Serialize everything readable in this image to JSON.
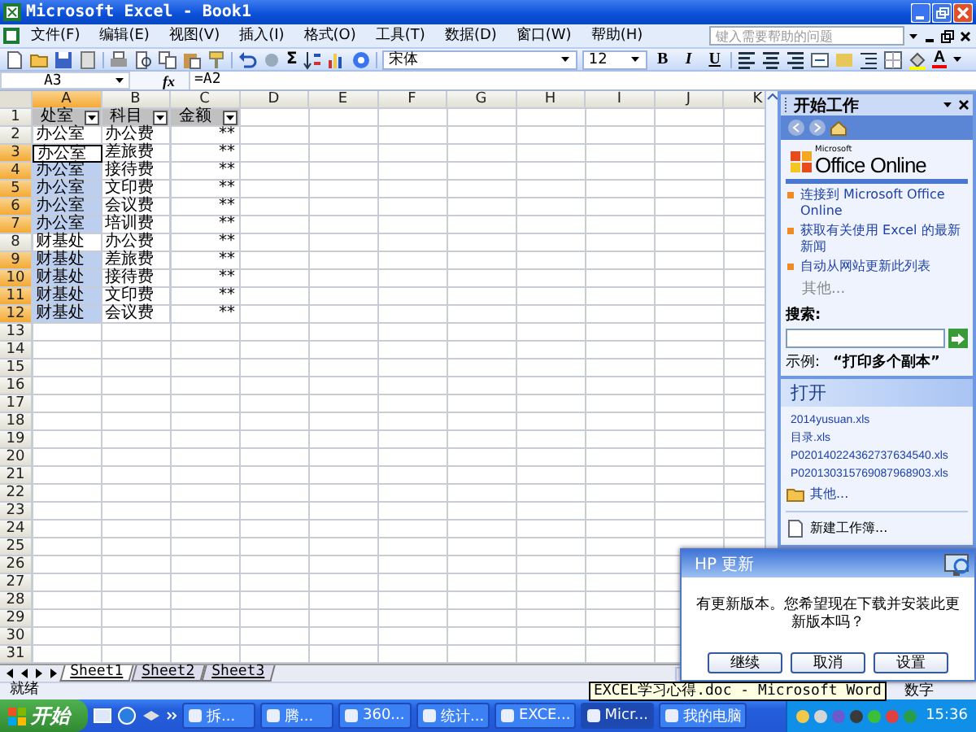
{
  "window": {
    "title": "Microsoft Excel - Book1"
  },
  "menu": [
    "文件(F)",
    "编辑(E)",
    "视图(V)",
    "插入(I)",
    "格式(O)",
    "工具(T)",
    "数据(D)",
    "窗口(W)",
    "帮助(H)"
  ],
  "help_box": {
    "placeholder": "键入需要帮助的问题"
  },
  "toolbar": {
    "sum": "Σ",
    "font": "宋体",
    "size": "12",
    "styles": [
      "B",
      "I",
      "U"
    ],
    "font_color": "A"
  },
  "formula_bar": {
    "name_box": "A3",
    "fx": "fx",
    "formula": "=A2"
  },
  "sheet": {
    "columns": [
      {
        "label": "A",
        "selected": true
      },
      {
        "label": "B",
        "selected": false
      },
      {
        "label": "C",
        "selected": false
      },
      {
        "label": "D",
        "selected": false
      },
      {
        "label": "E",
        "selected": false
      },
      {
        "label": "F",
        "selected": false
      },
      {
        "label": "G",
        "selected": false
      },
      {
        "label": "H",
        "selected": false
      },
      {
        "label": "I",
        "selected": false
      },
      {
        "label": "J",
        "selected": false
      },
      {
        "label": "K",
        "selected": false
      }
    ],
    "rows": [
      {
        "number": "1",
        "selected": false,
        "cells": [
          {
            "text": "处室",
            "kind": "header",
            "selected": false,
            "active": false
          },
          {
            "text": "科目",
            "kind": "header",
            "selected": false,
            "active": false
          },
          {
            "text": "金额",
            "kind": "header",
            "selected": false,
            "active": false
          }
        ]
      },
      {
        "number": "2",
        "selected": false,
        "cells": [
          {
            "text": "办公室",
            "kind": "text",
            "selected": false,
            "active": false
          },
          {
            "text": "办公费",
            "kind": "text",
            "selected": false,
            "active": false
          },
          {
            "text": "**",
            "kind": "number",
            "selected": false,
            "active": false
          }
        ]
      },
      {
        "number": "3",
        "selected": true,
        "cells": [
          {
            "text": "办公室",
            "kind": "text",
            "selected": false,
            "active": true
          },
          {
            "text": "差旅费",
            "kind": "text",
            "selected": false,
            "active": false
          },
          {
            "text": "**",
            "kind": "number",
            "selected": false,
            "active": false
          }
        ]
      },
      {
        "number": "4",
        "selected": true,
        "cells": [
          {
            "text": "办公室",
            "kind": "text",
            "selected": true,
            "active": false
          },
          {
            "text": "接待费",
            "kind": "text",
            "selected": false,
            "active": false
          },
          {
            "text": "**",
            "kind": "number",
            "selected": false,
            "active": false
          }
        ]
      },
      {
        "number": "5",
        "selected": true,
        "cells": [
          {
            "text": "办公室",
            "kind": "text",
            "selected": true,
            "active": false
          },
          {
            "text": "文印费",
            "kind": "text",
            "selected": false,
            "active": false
          },
          {
            "text": "**",
            "kind": "number",
            "selected": false,
            "active": false
          }
        ]
      },
      {
        "number": "6",
        "selected": true,
        "cells": [
          {
            "text": "办公室",
            "kind": "text",
            "selected": true,
            "active": false
          },
          {
            "text": "会议费",
            "kind": "text",
            "selected": false,
            "active": false
          },
          {
            "text": "**",
            "kind": "number",
            "selected": false,
            "active": false
          }
        ]
      },
      {
        "number": "7",
        "selected": true,
        "cells": [
          {
            "text": "办公室",
            "kind": "text",
            "selected": true,
            "active": false
          },
          {
            "text": "培训费",
            "kind": "text",
            "selected": false,
            "active": false
          },
          {
            "text": "**",
            "kind": "number",
            "selected": false,
            "active": false
          }
        ]
      },
      {
        "number": "8",
        "selected": false,
        "cells": [
          {
            "text": "财基处",
            "kind": "text",
            "selected": false,
            "active": false
          },
          {
            "text": "办公费",
            "kind": "text",
            "selected": false,
            "active": false
          },
          {
            "text": "**",
            "kind": "number",
            "selected": false,
            "active": false
          }
        ]
      },
      {
        "number": "9",
        "selected": true,
        "cells": [
          {
            "text": "财基处",
            "kind": "text",
            "selected": true,
            "active": false
          },
          {
            "text": "差旅费",
            "kind": "text",
            "selected": false,
            "active": false
          },
          {
            "text": "**",
            "kind": "number",
            "selected": false,
            "active": false
          }
        ]
      },
      {
        "number": "10",
        "selected": true,
        "cells": [
          {
            "text": "财基处",
            "kind": "text",
            "selected": true,
            "active": false
          },
          {
            "text": "接待费",
            "kind": "text",
            "selected": false,
            "active": false
          },
          {
            "text": "**",
            "kind": "number",
            "selected": false,
            "active": false
          }
        ]
      },
      {
        "number": "11",
        "selected": true,
        "cells": [
          {
            "text": "财基处",
            "kind": "text",
            "selected": true,
            "active": false
          },
          {
            "text": "文印费",
            "kind": "text",
            "selected": false,
            "active": false
          },
          {
            "text": "**",
            "kind": "number",
            "selected": false,
            "active": false
          }
        ]
      },
      {
        "number": "12",
        "selected": true,
        "cells": [
          {
            "text": "财基处",
            "kind": "text",
            "selected": true,
            "active": false
          },
          {
            "text": "会议费",
            "kind": "text",
            "selected": false,
            "active": false
          },
          {
            "text": "**",
            "kind": "number",
            "selected": false,
            "active": false
          }
        ]
      },
      {
        "number": "13",
        "selected": false
      },
      {
        "number": "14",
        "selected": false
      },
      {
        "number": "15",
        "selected": false
      },
      {
        "number": "16",
        "selected": false
      },
      {
        "number": "17",
        "selected": false
      },
      {
        "number": "18",
        "selected": false
      },
      {
        "number": "19",
        "selected": false
      },
      {
        "number": "20",
        "selected": false
      },
      {
        "number": "21",
        "selected": false
      },
      {
        "number": "22",
        "selected": false
      },
      {
        "number": "23",
        "selected": false
      },
      {
        "number": "24",
        "selected": false
      },
      {
        "number": "25",
        "selected": false
      },
      {
        "number": "26",
        "selected": false
      },
      {
        "number": "27",
        "selected": false
      },
      {
        "number": "28",
        "selected": false
      },
      {
        "number": "29",
        "selected": false
      },
      {
        "number": "30",
        "selected": false
      },
      {
        "number": "31",
        "selected": false
      }
    ],
    "tabs": [
      {
        "label": "Sheet1",
        "selected": true
      },
      {
        "label": "Sheet2",
        "selected": false
      },
      {
        "label": "Sheet3",
        "selected": false
      }
    ]
  },
  "task_pane": {
    "title": "开始工作",
    "logo": {
      "small": "Microsoft",
      "name": "Office Online"
    },
    "links": [
      "连接到 Microsoft Office Online",
      "获取有关使用 Excel 的最新新闻",
      "自动从网站更新此列表"
    ],
    "more": "其他...",
    "search": {
      "label": "搜索:",
      "example_label": "示例:",
      "example": "“打印多个副本”"
    },
    "open": {
      "title": "打开",
      "files": [
        "2014yusuan.xls",
        "目录.xls",
        "P020140224362737634540.xls",
        "P020130315769087968903.xls"
      ],
      "more": "其他..."
    },
    "new_workbook": "新建工作簿..."
  },
  "status_bar": {
    "left": "就绪",
    "right": "数字"
  },
  "tooltip": "EXCEL学习心得.doc - Microsoft Word",
  "dialog": {
    "title": "HP 更新",
    "message": "有更新版本。您希望现在下载并安装此更新版本吗？",
    "buttons": [
      "继续",
      "取消",
      "设置"
    ]
  },
  "taskbar": {
    "start": "开始",
    "tasks": [
      {
        "label": "拆...",
        "selected": false
      },
      {
        "label": "腾...",
        "selected": false
      },
      {
        "label": "360...",
        "selected": false
      },
      {
        "label": "统计...",
        "selected": false
      },
      {
        "label": "EXCE...",
        "selected": false
      },
      {
        "label": "Micr...",
        "selected": true
      },
      {
        "label": "我的电脑",
        "selected": false
      }
    ],
    "clock": "15:36"
  }
}
